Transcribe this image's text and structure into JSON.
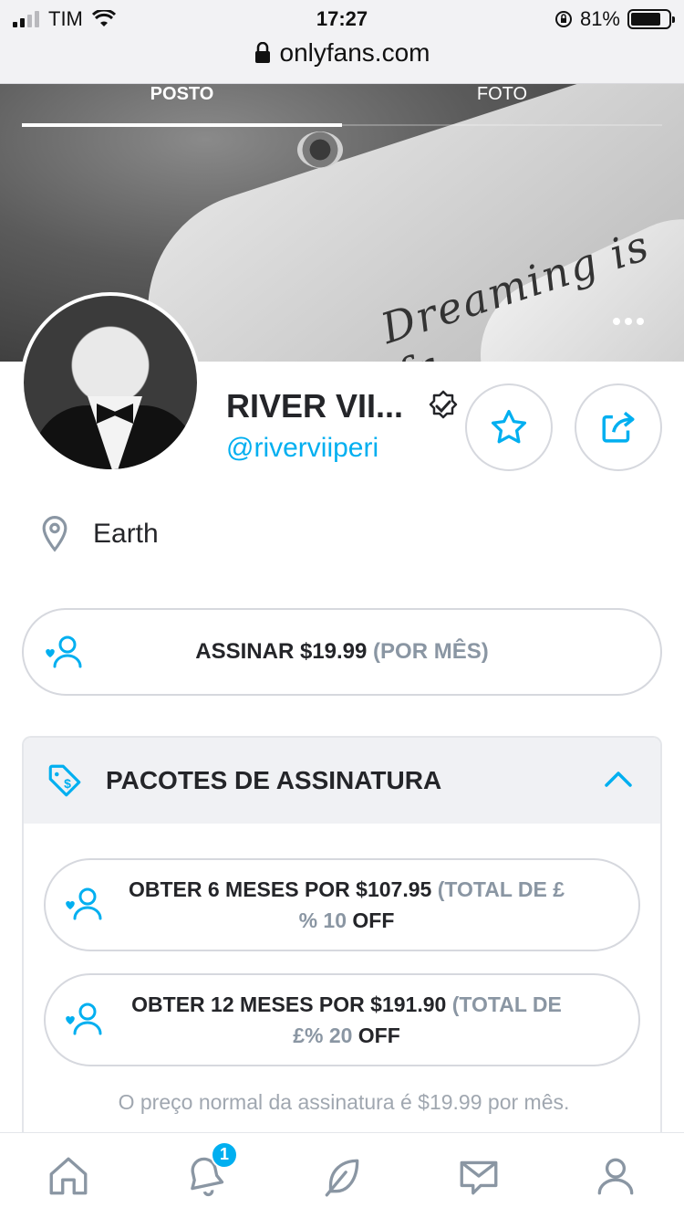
{
  "status_bar": {
    "carrier": "TIM",
    "time": "17:27",
    "battery": "81%",
    "battery_level": 0.81
  },
  "browser": {
    "url": "onlyfans.com"
  },
  "tabs": [
    {
      "label": "POSTO",
      "active": true
    },
    {
      "label": "FOTO",
      "active": false
    }
  ],
  "profile": {
    "name": "RIVER VII...",
    "handle": "@riverviiperi",
    "verified": true,
    "location": "Earth"
  },
  "subscribe": {
    "label": "ASSINAR $19.99",
    "period": "(POR MÊS)"
  },
  "bundles": {
    "title": "PACOTES DE ASSINATURA",
    "items": [
      {
        "label": "OBTER 6 MESES POR $107.95",
        "discount_prefix": "(TOTAL DE £% 10",
        "discount_suffix": "OFF"
      },
      {
        "label": "OBTER 12 MESES POR $191.90",
        "discount_prefix": "(TOTAL DE £% 20",
        "discount_suffix": "OFF"
      }
    ],
    "note": "O preço normal da assinatura é $19.99 por mês."
  },
  "nav": {
    "notifications_badge": "1"
  },
  "colors": {
    "accent": "#00aff0",
    "muted": "#8a96a3",
    "border": "#d6d8de"
  }
}
